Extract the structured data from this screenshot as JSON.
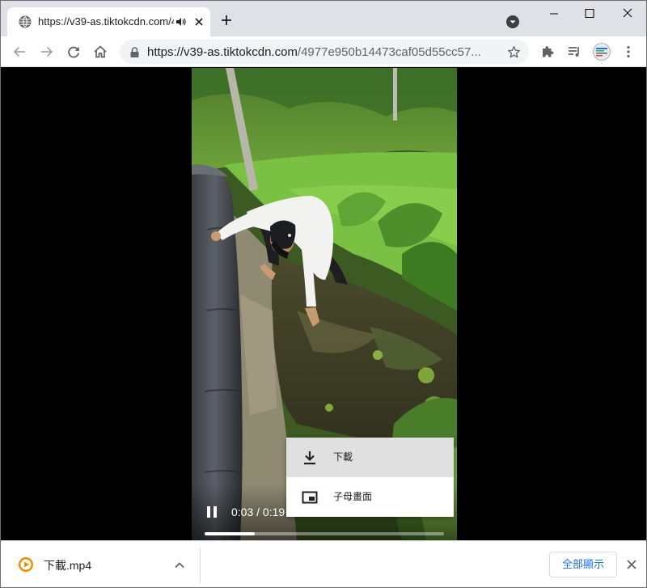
{
  "tab": {
    "title": "https://v39-as.tiktokcdn.com/4977e950b14473caf05d55cc57..."
  },
  "omnibox": {
    "url_host": "https://v39-as.tiktokcdn.com",
    "url_path": "/4977e950b14473caf05d55cc57..."
  },
  "player": {
    "time": "0:03 / 0:19",
    "progress": 0.21
  },
  "context_menu": {
    "items": [
      {
        "label": "下載",
        "icon": "download-icon",
        "highlighted": true
      },
      {
        "label": "子母畫面",
        "icon": "picture-in-picture-icon",
        "highlighted": false
      }
    ]
  },
  "download_shelf": {
    "file_name": "下載.mp4",
    "show_all_label": "全部顯示"
  },
  "colors": {
    "tabstrip_bg": "#dee1e6",
    "link_blue": "#1a73e8",
    "download_orange": "#f28b00"
  }
}
